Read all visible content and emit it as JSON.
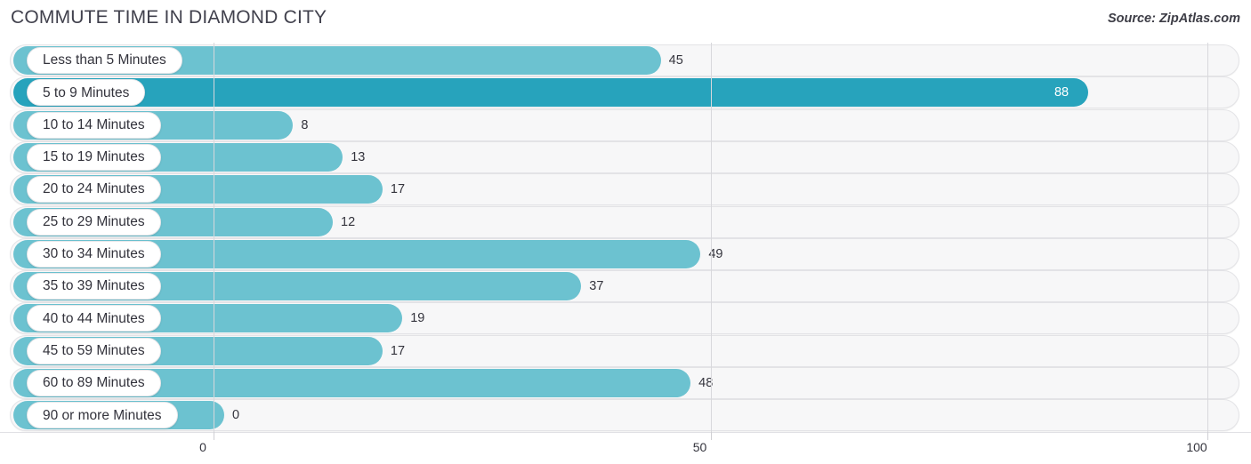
{
  "header": {
    "title": "COMMUTE TIME IN DIAMOND CITY",
    "source": "Source: ZipAtlas.com"
  },
  "colors": {
    "bar_normal": "#6CC2D0",
    "bar_highlight": "#27A3BC",
    "track_fill": "#F7F7F8",
    "track_border": "#E3E3E6",
    "gridline": "#D8D8DC",
    "text": "#34343D",
    "value_inside": "#FFFFFF"
  },
  "chart_data": {
    "type": "bar",
    "orientation": "horizontal",
    "title": "COMMUTE TIME IN DIAMOND CITY",
    "xlabel": "",
    "ylabel": "",
    "xlim": [
      0,
      100
    ],
    "grid": true,
    "legend": null,
    "xticks": [
      "0",
      "50",
      "100"
    ],
    "xtick_values": [
      0,
      50,
      100
    ],
    "categories": [
      "Less than 5 Minutes",
      "5 to 9 Minutes",
      "10 to 14 Minutes",
      "15 to 19 Minutes",
      "20 to 24 Minutes",
      "25 to 29 Minutes",
      "30 to 34 Minutes",
      "35 to 39 Minutes",
      "40 to 44 Minutes",
      "45 to 59 Minutes",
      "60 to 89 Minutes",
      "90 or more Minutes"
    ],
    "values": [
      45,
      88,
      8,
      13,
      17,
      12,
      49,
      37,
      19,
      17,
      48,
      0
    ],
    "value_labels": [
      "45",
      "88",
      "8",
      "13",
      "17",
      "12",
      "49",
      "37",
      "19",
      "17",
      "48",
      "0"
    ],
    "highlighted": [
      false,
      true,
      false,
      false,
      false,
      false,
      false,
      false,
      false,
      false,
      false,
      false
    ]
  }
}
